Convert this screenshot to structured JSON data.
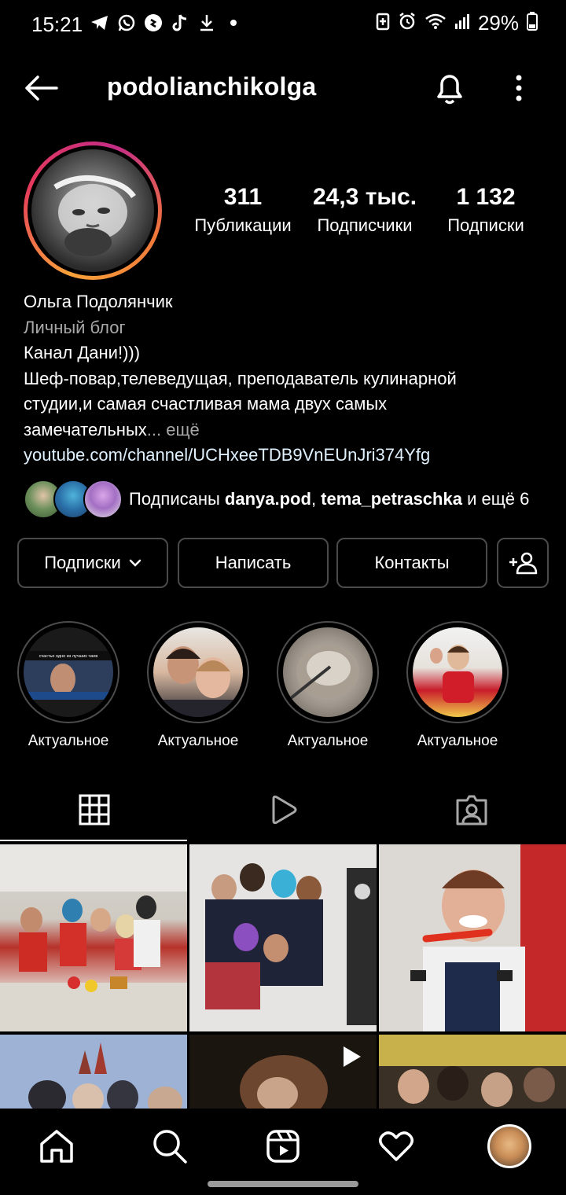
{
  "status_bar": {
    "time": "15:21",
    "battery": "29%",
    "left_icons": [
      "telegram-icon",
      "whatsapp-icon",
      "shazam-icon",
      "tiktok-icon",
      "download-icon",
      "dot-icon"
    ],
    "right_icons": [
      "battery-saver-icon",
      "alarm-icon",
      "wifi-icon",
      "signal-icon",
      "battery-icon"
    ]
  },
  "header": {
    "username": "podolianchikolga"
  },
  "profile": {
    "stats": {
      "posts_count": "311",
      "posts_label": "Публикации",
      "followers_count": "24,3 тыс.",
      "followers_label": "Подписчики",
      "following_count": "1 132",
      "following_label": "Подписки"
    },
    "bio": {
      "name": "Ольга Подолянчик",
      "category": "Личный блог",
      "line1": "Канал Дани!)))",
      "line2": "Шеф-повар,телеведущая, преподаватель кулинарной",
      "line3": "студии,и самая счастливая  мама двух самых",
      "line4": "замечательных",
      "more": "... ещё",
      "link": "youtube.com/channel/UCHxeeTDB9VnEUnJri374Yfg"
    },
    "followed_by": {
      "prefix": "Подписаны ",
      "user1": "danya.pod",
      "separator": ", ",
      "user2": "tema_petraschka",
      "suffix": " и ещё 6"
    },
    "actions": {
      "following": "Подписки",
      "message": "Написать",
      "contacts": "Контакты"
    }
  },
  "highlights": [
    {
      "label": "Актуальное",
      "image_text": "счастье одно из лучших чаев"
    },
    {
      "label": "Актуальное"
    },
    {
      "label": "Актуальное"
    },
    {
      "label": "Актуальное"
    }
  ],
  "tabs": [
    "grid-icon",
    "reels-icon",
    "tagged-icon"
  ],
  "bottom_nav": [
    "home-icon",
    "search-icon",
    "reels-icon",
    "heart-icon",
    "profile-avatar"
  ]
}
